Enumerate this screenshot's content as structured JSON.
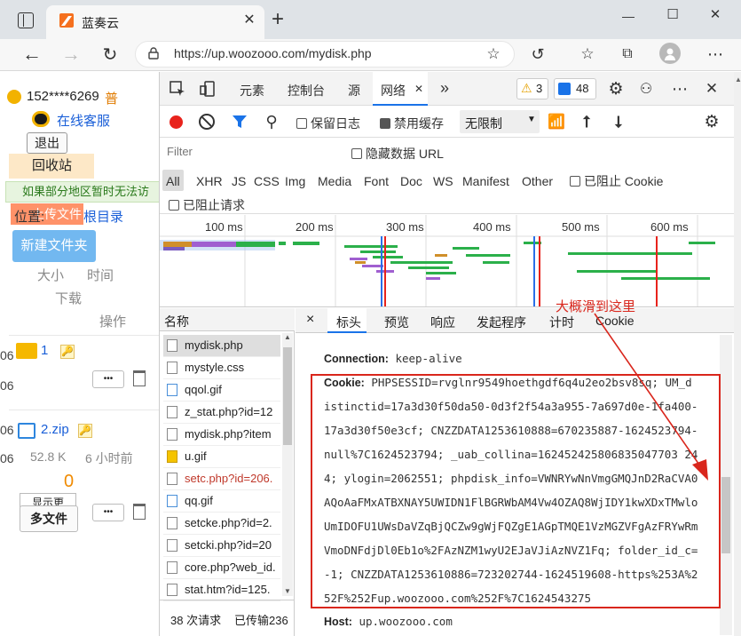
{
  "browser": {
    "tab_title": "蓝奏云",
    "url": "https://up.woozooo.com/mydisk.php",
    "new_tab": "+",
    "window_controls": [
      "—",
      "☐",
      "✕"
    ]
  },
  "page": {
    "user": "152****6269",
    "user_badge": "普",
    "service": "在线客服",
    "logout": "退出",
    "recycle": "回收站",
    "notice": "如果部分地区暂时无法访",
    "upload": "上传文件",
    "location_label": "位置:",
    "root_dir": "根目录",
    "new_folder": "新建文件夹",
    "col_size": "大小",
    "col_time": "时间",
    "col_download": "下载",
    "col_ops": "操作",
    "folder_name": "1",
    "file_name": "2.zip",
    "file_size": "52.8 K",
    "file_time": "6 小时前",
    "download_count": "0",
    "show_more": "显示更",
    "more_files": "多文件",
    "dots": "•••",
    "left_edge_chars": [
      "06",
      "06",
      "06",
      "06"
    ]
  },
  "devtools": {
    "tabs": [
      "元素",
      "控制台",
      "源",
      "网络"
    ],
    "active_tab": "网络",
    "more": "»",
    "warnings": "3",
    "messages": "48",
    "preserve_log": "保留日志",
    "disable_cache": "禁用缓存",
    "throttle": "无限制",
    "filter_placeholder": "Filter",
    "hide_data_url": "隐藏数据 URL",
    "types": [
      "All",
      "XHR",
      "JS",
      "CSS",
      "Img",
      "Media",
      "Font",
      "Doc",
      "WS",
      "Manifest",
      "Other"
    ],
    "blocked_cookie": "已阻止 Cookie",
    "blocked_requests": "已阻止请求",
    "timeline_ticks": [
      "100 ms",
      "200 ms",
      "300 ms",
      "400 ms",
      "500 ms",
      "600 ms"
    ],
    "name_header": "名称",
    "files": [
      "mydisk.php",
      "mystyle.css",
      "qqol.gif",
      "z_stat.php?id=12",
      "mydisk.php?item",
      "u.gif",
      "setc.php?id=206.",
      "qq.gif",
      "setcke.php?id=2.",
      "setcki.php?id=20",
      "core.php?web_id.",
      "stat.htm?id=125."
    ],
    "footer_requests": "38 次请求",
    "footer_transferred": "已传输236",
    "detail_tabs": [
      "标头",
      "预览",
      "响应",
      "发起程序",
      "计时",
      "Cookie"
    ],
    "close_detail": "×",
    "headers": {
      "connection_key": "Connection:",
      "connection_val": "keep-alive",
      "cookie_key": "Cookie:",
      "cookie_lines": [
        "PHPSESSID=rvglnr9549hoethgdf6q4u2eo2bsv8sq; UM_d",
        "istinctid=17a3d30f50da50-0d3f2f54a3a955-7a697d0e-1fa400-",
        "17a3d30f50e3cf; CNZZDATA1253610888=670235887-1624523794-",
        "null%7C1624523794; _uab_collina=162452425806835047703 24",
        "4; ylogin=2062551; phpdisk_info=VWNRYwNnVmgGMQJnD2RaCVA0",
        "AQoAaFMxATBXNAY5UWIDN1FlBGRWbAM4Vw4OZAQ8WjIDY1kwXDxTMwlo",
        "UmIDOFU1UWsDaVZqBjQCZw9gWjFQZgE1AGpTMQE1VzMGZVFgAzFRYwRm",
        "VmoDNFdjDl0Eb1o%2FAzNZM1wyU2EJaVJiAzNVZ1Fq; folder_id_c=",
        "-1; CNZZDATA1253610886=723202744-1624519608-https%253A%2",
        "52F%252Fup.woozooo.com%252F%7C1624543275"
      ],
      "host_key": "Host:",
      "host_val": "up.woozooo.com"
    },
    "annotation": "大概滑到这里"
  },
  "colors": {
    "accent_blue": "#1a73e8",
    "record_red": "#e8231c",
    "annotation_red": "#d9261c"
  }
}
